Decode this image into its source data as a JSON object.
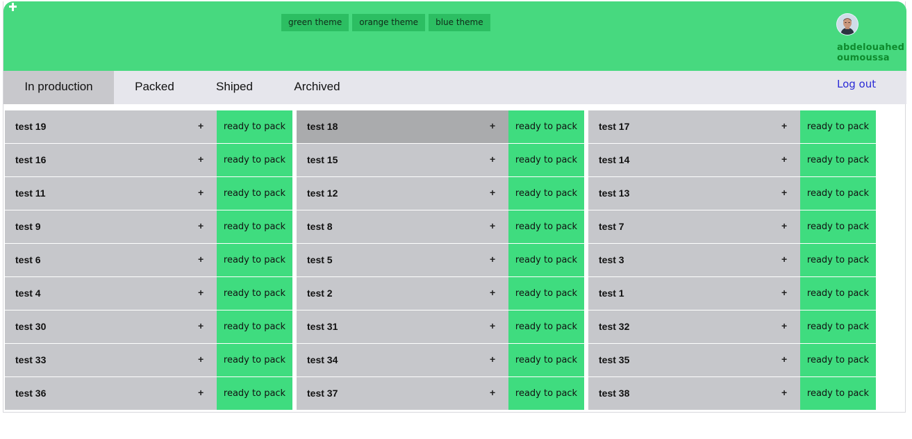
{
  "header": {
    "add_icon": "plus-icon",
    "themes": [
      "green theme",
      "orange theme",
      "blue theme"
    ],
    "user": {
      "first_name": "abdelouahed",
      "last_name": "oumoussa",
      "avatar_icon": "user-avatar"
    },
    "colors": {
      "header_bg": "#47d97f",
      "theme_button_bg": "#2cbe62",
      "user_name": "#0e8a2d"
    }
  },
  "tabs": [
    "In production",
    "Packed",
    "Shiped",
    "Archived"
  ],
  "active_tab": "In production",
  "logout_label": "Log out",
  "orders": [
    [
      "test 19",
      "test 18",
      "test 17"
    ],
    [
      "test 16",
      "test 15",
      "test 14"
    ],
    [
      "test 11",
      "test 12",
      "test 13"
    ],
    [
      "test 9",
      "test 8",
      "test 7"
    ],
    [
      "test 6",
      "test 5",
      "test 3"
    ],
    [
      "test 4",
      "test 2",
      "test 1"
    ],
    [
      "test 30",
      "test 31",
      "test 32"
    ],
    [
      "test 33",
      "test 34",
      "test 35"
    ],
    [
      "test 36",
      "test 37",
      "test 38"
    ]
  ],
  "order_action_symbol": "+",
  "status_label": "ready to pack",
  "colors": {
    "card_bg": "#c6c7cb",
    "card_hover_bg": "#aaabad",
    "status_bg": "#3fdc7f",
    "tabs_bg": "#e6e6ec",
    "active_tab_bg": "#c8c8cc",
    "logout_link": "#2a2ad6"
  }
}
